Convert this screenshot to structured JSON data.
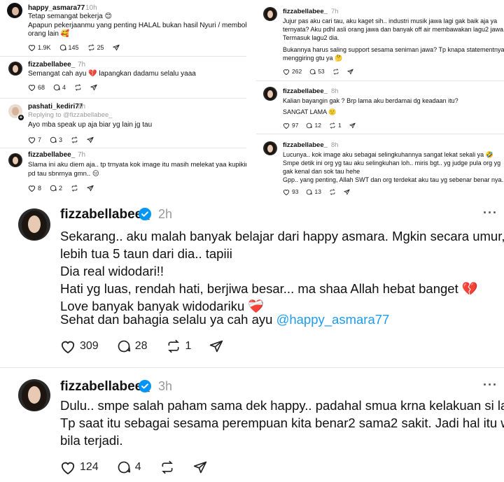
{
  "colors": {
    "accent": "#0095f6",
    "mention": "#1d9bf0",
    "heart_emoji": "#c2185b"
  },
  "left_thread": {
    "post1": {
      "username": "happy_asmara77",
      "time": "10h",
      "line1": "Tetap semangat bekerja 😊",
      "line2": "Apapun pekerjaanmu yang penting HALAL bukan hasil Nyuri / membohongi",
      "line3": "orang lain 🥰",
      "likes": "1.9K",
      "comments": "145",
      "reposts": "25"
    },
    "post2": {
      "username": "fizzabellabee_",
      "time": "7h",
      "line1": "Semangat cah ayu 💔 lapangkan dadamu selalu yaaa",
      "likes": "68",
      "comments": "4"
    },
    "post3": {
      "username": "pashati_kediri77",
      "time": "8h",
      "reply_to": "Replying to @fizzabellabee_",
      "line1": "Ayo mba speak up aja biar yg lain jg tau",
      "likes": "7",
      "comments": "3"
    },
    "post4": {
      "username": "fizzabellabee_",
      "time": "7h",
      "line1": "Slama ini aku diem aja.. tp trnyata kok image itu masih melekat yaa kupikir sudah",
      "line2": "pd tau sbnrnya gmn.. 😑",
      "likes": "8",
      "comments": "2"
    }
  },
  "right_thread": {
    "post1": {
      "username": "fizzabellabee_",
      "time": "7h",
      "line1": "Jujur pas aku cari tau, aku kaget sih.. industri musik jawa lagi gak baik aja ya",
      "line2": "ternyata? Aku pdhl asli orang jawa dan banyak off air membawakan lagu2 jawa.",
      "line3": "Termasuk lagu2 dia.",
      "line4": "Bukannya harus saling support sesama seniman jawa? Tp knapa statementnya jadi",
      "line5": "menggiring gtu ya 🤔",
      "likes": "262",
      "comments": "53"
    },
    "post2": {
      "username": "fizzabellabee_",
      "time": "8h",
      "line1": "Kalian bayangin gak ? Brp lama aku berdamai dg keadaan itu?",
      "line2": "SANGAT LAMA 🙂",
      "likes": "97",
      "comments": "12",
      "reposts": "1"
    },
    "post3": {
      "username": "fizzabellabee_",
      "time": "8h",
      "line1": "Lucunya.. kok image aku sebagai selingkuhannya sangat lekat sekali ya 🤣",
      "line2": "Smpe detik ini org yg tau aku selingkuhan loh.. miris bgt.. yg judge pula org yg",
      "line3": "gak kenal dan sok tau hehe",
      "line4": "Gpp.. yang penting, Allah SWT dan org terdekat aku tau yg sebenar benar nya..",
      "likes": "93",
      "comments": "13"
    }
  },
  "main_post1": {
    "username": "fizzabellabee_",
    "time": "2h",
    "more": "···",
    "line1": "Sekarang.. aku malah banyak belajar dari happy asmara. Mgkin secara umur, aku",
    "line2": "lebih tua 5 taun dari dia.. tapiii",
    "line3": "Dia real widodari!!",
    "line4": "Hati yg luas, rendah hati, berjiwa besar... ma shaa Allah hebat banget 💔",
    "line5": "Love banyak banyak widodariku ❤️‍🩹",
    "line6_prefix": "Sehat dan bahagia selalu ya cah ayu ",
    "line6_mention": "@happy_asmara77",
    "likes": "309",
    "comments": "28",
    "reposts": "1"
  },
  "main_post2": {
    "username": "fizzabellabee_",
    "time": "3h",
    "more": "···",
    "line1": "Dulu.. smpe salah paham sama dek happy.. padahal smua krna kelakuan si laki",
    "line2": "Tp saat itu sebagai sesama perempuan kita benar2 sama2 sakit. Jadi hal itu wajar",
    "line3": "bila terjadi.",
    "likes": "124",
    "comments": "4"
  },
  "icons": [
    "heart-icon",
    "comment-icon",
    "repost-icon",
    "share-icon",
    "verified-icon",
    "more-icon"
  ]
}
